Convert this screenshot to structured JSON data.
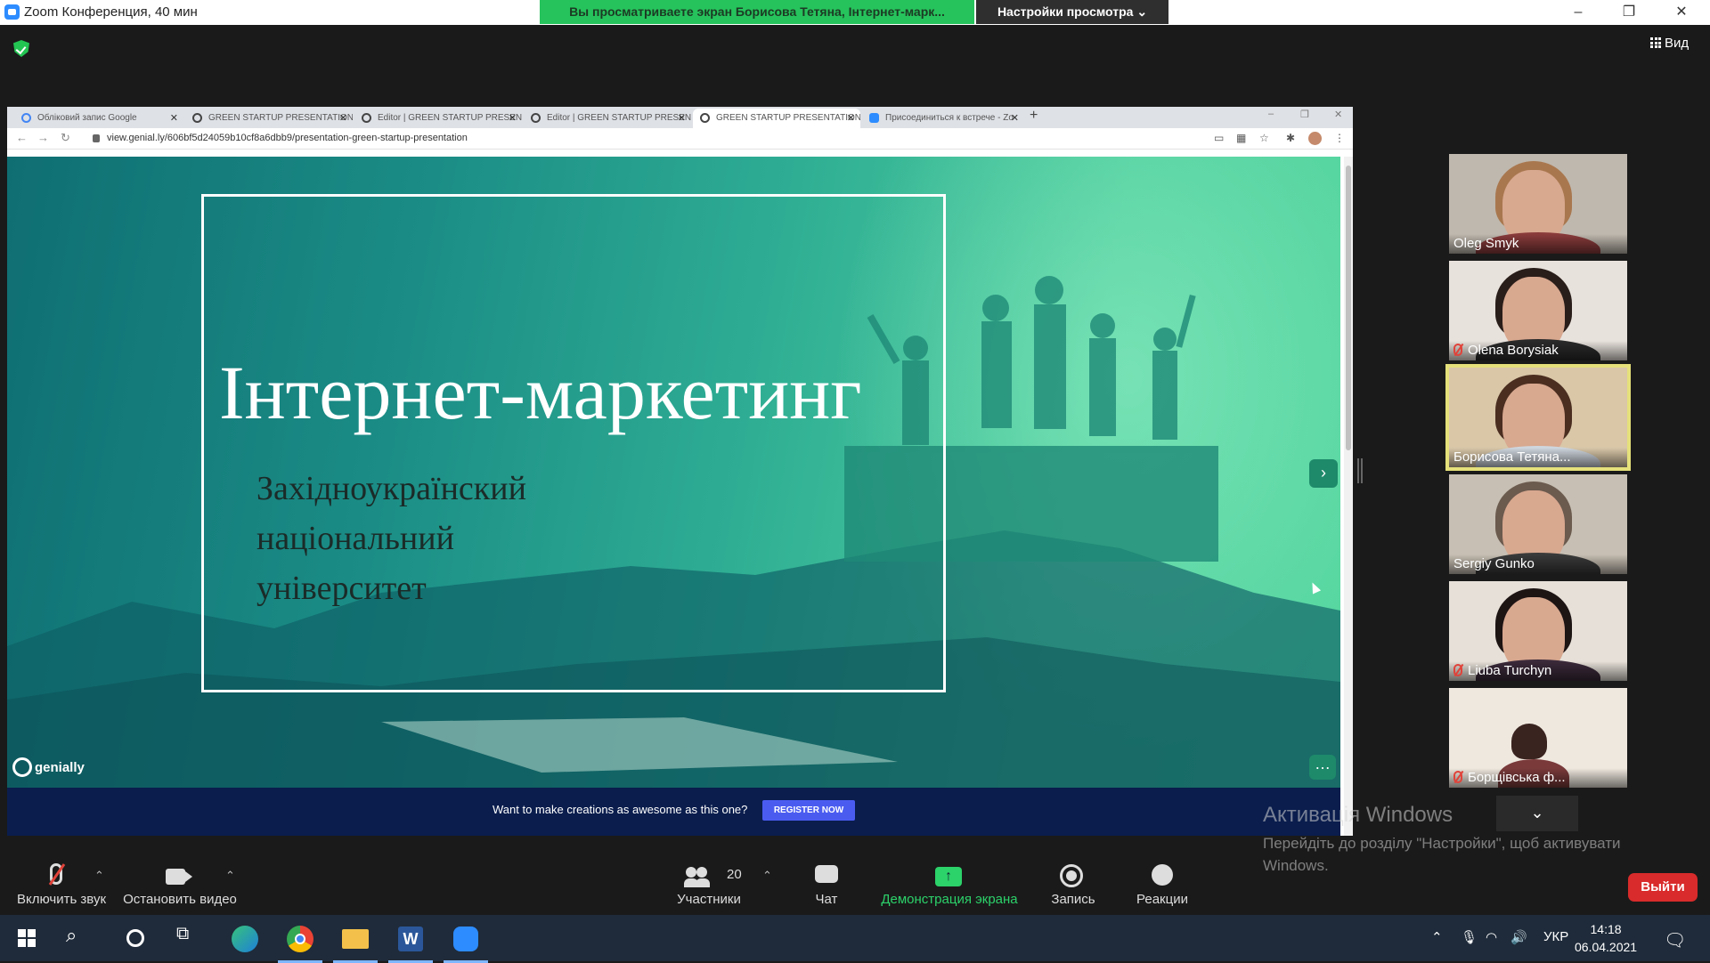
{
  "zoom": {
    "window_title": "Zoom Конференция, 40 мин",
    "share_banner": "Вы просматриваете экран Борисова Тетяна, Інтернет-марк...",
    "view_options": "Настройки просмотра",
    "view_button": "Вид"
  },
  "browser": {
    "tabs": [
      {
        "title": "Обліковий запис Google",
        "favicon": "google-icon"
      },
      {
        "title": "GREEN STARTUP PRESENTATION",
        "favicon": "genially-icon"
      },
      {
        "title": "Editor | GREEN STARTUP PRESEN",
        "favicon": "genially-icon"
      },
      {
        "title": "Editor | GREEN STARTUP PRESEN",
        "favicon": "genially-icon"
      },
      {
        "title": "GREEN STARTUP PRESENTATION",
        "favicon": "genially-icon",
        "active": true
      },
      {
        "title": "Присоединиться к встрече - Zo",
        "favicon": "zoom-icon"
      }
    ],
    "url": "view.genial.ly/606bf5d24059b10cf8a6dbb9/presentation-green-startup-presentation"
  },
  "slide": {
    "title": "Інтернет-маркетинг",
    "subtitle_lines": [
      "Західноукраїнский",
      "національний",
      "університет"
    ],
    "brand": "genially",
    "promo_text": "Want to make creations as awesome as this one?",
    "promo_button": "REGISTER NOW"
  },
  "participants": [
    {
      "name": "Oleg Smyk",
      "muted": false,
      "active_speaker": false
    },
    {
      "name": "Olena Borysiak",
      "muted": true,
      "active_speaker": false
    },
    {
      "name": "Борисова Тетяна...",
      "muted": false,
      "active_speaker": true
    },
    {
      "name": "Sergiy Gunko",
      "muted": false,
      "active_speaker": false
    },
    {
      "name": "Liuba Turchyn",
      "muted": true,
      "active_speaker": false
    },
    {
      "name": "Борщівська ф...",
      "muted": true,
      "active_speaker": false
    }
  ],
  "watermark": {
    "title": "Активація Windows",
    "text": "Перейдіть до розділу \"Настройки\", щоб активувати Windows."
  },
  "toolbar": {
    "unmute": "Включить звук",
    "stop_video": "Остановить видео",
    "participants_count": "20",
    "participants": "Участники",
    "chat": "Чат",
    "share_screen": "Демонстрация экрана",
    "record": "Запись",
    "reactions": "Реакции",
    "leave": "Выйти"
  },
  "taskbar": {
    "language": "УКР",
    "time": "14:18",
    "date": "06.04.2021"
  },
  "colors": {
    "share_green": "#26c35c",
    "leave_red": "#d92b2b",
    "active_speaker": "#e5e07a",
    "promo_bg": "#0a1d4d"
  }
}
